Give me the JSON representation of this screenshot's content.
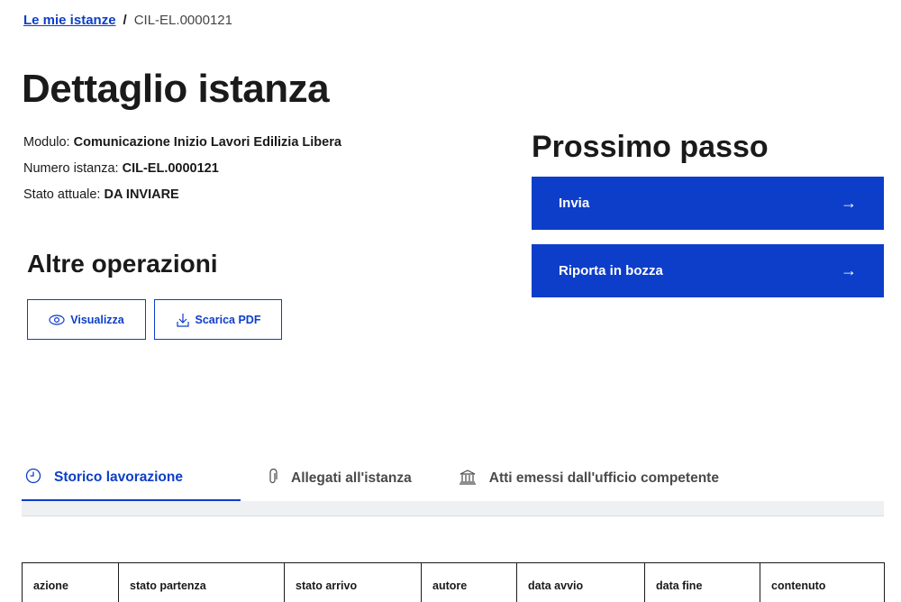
{
  "breadcrumb": {
    "link": "Le mie istanze",
    "separator": "/",
    "current": "CIL-EL.0000121"
  },
  "title": "Dettaglio istanza",
  "meta": {
    "modulo_label": "Modulo: ",
    "modulo_value": "Comunicazione Inizio Lavori Edilizia Libera",
    "numero_label": "Numero istanza: ",
    "numero_value": "CIL-EL.0000121",
    "stato_label": "Stato attuale: ",
    "stato_value": "DA INVIARE"
  },
  "altre_operazioni": {
    "title": "Altre operazioni",
    "visualizza_label": "Visualizza",
    "visualizza_icon": "eye-icon",
    "scarica_label": "Scarica PDF",
    "scarica_icon": "download-icon"
  },
  "prossimo_passo": {
    "title": "Prossimo passo",
    "invia_label": "Invia",
    "bozza_label": "Riporta in bozza",
    "arrow": "→"
  },
  "tabs": [
    {
      "label": "Storico lavorazione",
      "icon": "clock-icon",
      "active": true
    },
    {
      "label": "Allegati all'istanza",
      "icon": "paperclip-icon",
      "active": false
    },
    {
      "label": "Atti emessi dall'ufficio competente",
      "icon": "bank-icon",
      "active": false
    }
  ],
  "table": {
    "columns": [
      "azione",
      "stato partenza",
      "stato arrivo",
      "autore",
      "data avvio",
      "data fine",
      "contenuto"
    ]
  },
  "colors": {
    "primary": "#0d3ec9",
    "text": "#1a1a1a"
  }
}
